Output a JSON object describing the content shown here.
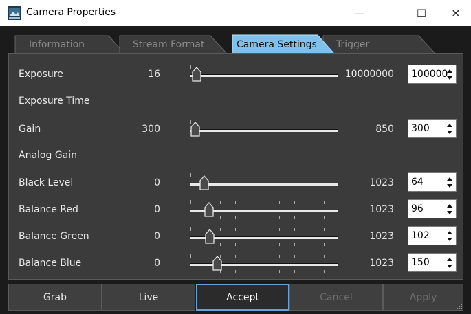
{
  "window": {
    "title": "Camera Properties"
  },
  "titlebar": {
    "minimize": "—",
    "maximize": "☐",
    "close": "✕"
  },
  "tabs": [
    {
      "label": "Information",
      "active": false
    },
    {
      "label": "Stream Format",
      "active": false
    },
    {
      "label": "Camera Settings",
      "active": true
    },
    {
      "label": "Trigger",
      "active": false
    }
  ],
  "settings": {
    "exposure": {
      "label": "Exposure",
      "min": "16",
      "max": "10000000",
      "value": "100000",
      "level": 0.0084
    },
    "exposure_time": {
      "label": "Exposure Time"
    },
    "gain": {
      "label": "Gain",
      "min": "300",
      "max": "850",
      "value": "300",
      "level": 0.0
    },
    "analog_gain": {
      "label": "Analog Gain"
    },
    "black_level": {
      "label": "Black Level",
      "min": "0",
      "max": "1023",
      "value": "64",
      "level": 0.0626
    },
    "balance_red": {
      "label": "Balance Red",
      "min": "0",
      "max": "1023",
      "value": "96",
      "level": 0.0938
    },
    "balance_green": {
      "label": "Balance Green",
      "min": "0",
      "max": "1023",
      "value": "102",
      "level": 0.0997
    },
    "balance_blue": {
      "label": "Balance Blue",
      "min": "0",
      "max": "1023",
      "value": "150",
      "level": 0.1466
    }
  },
  "buttons": {
    "grab": "Grab",
    "live": "Live",
    "accept": "Accept",
    "cancel": "Cancel",
    "apply": "Apply"
  },
  "colors": {
    "accent": "#6aa3d8",
    "active_tab": "#7fc1ea",
    "panel": "#3b3b3b",
    "background": "#1b1b1b"
  }
}
